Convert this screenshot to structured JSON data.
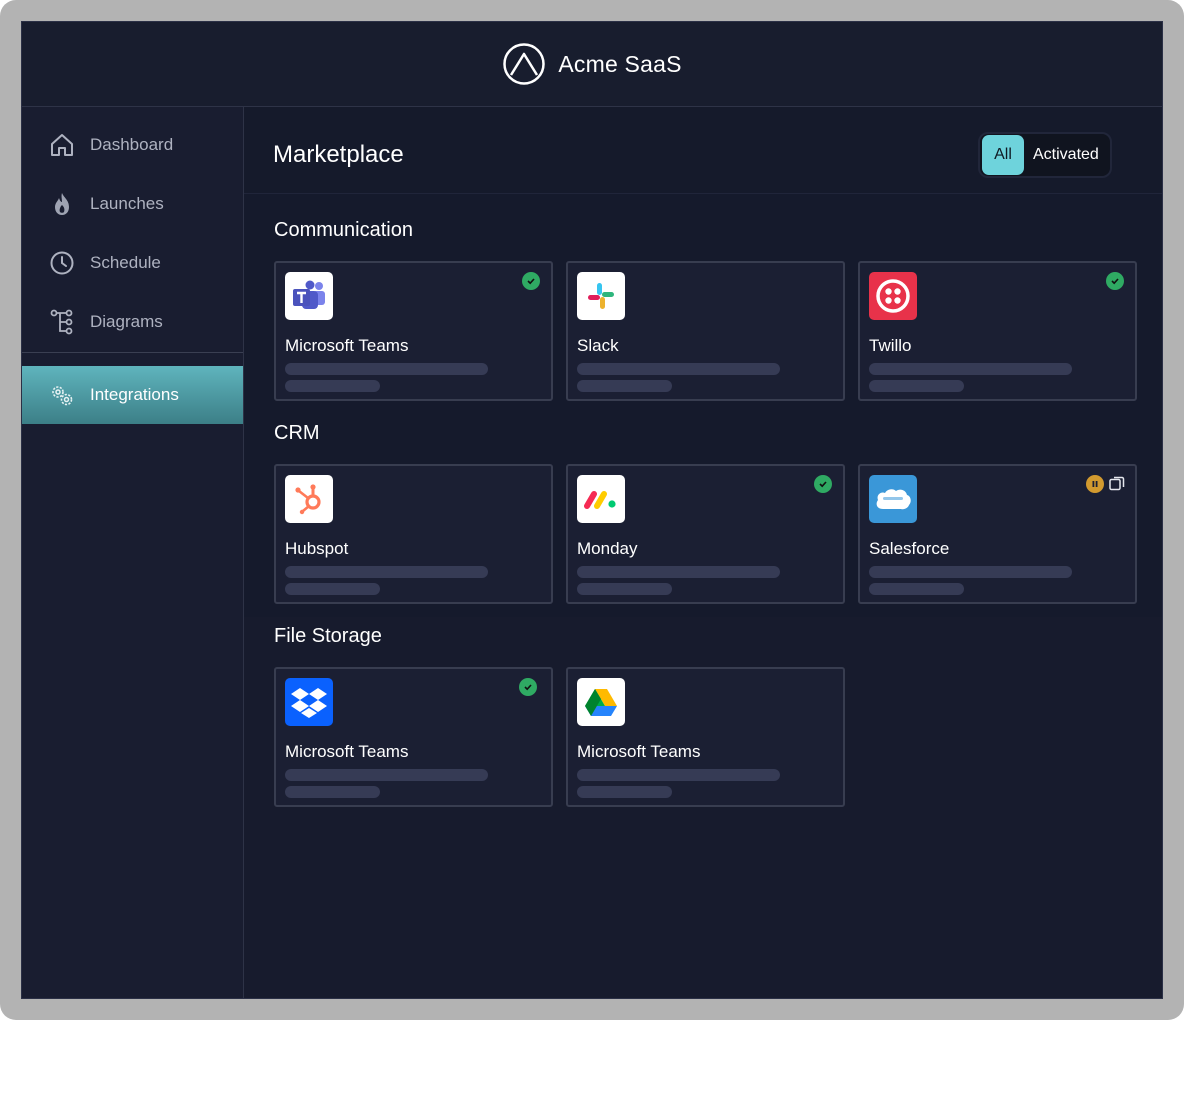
{
  "app": {
    "title": "Acme SaaS",
    "logo_icon": "peak-logo-icon"
  },
  "sidebar": {
    "items": [
      {
        "label": "Dashboard",
        "icon": "home-icon"
      },
      {
        "label": "Launches",
        "icon": "flame-icon"
      },
      {
        "label": "Schedule",
        "icon": "clock-icon"
      },
      {
        "label": "Diagrams",
        "icon": "tree-diagram-icon"
      }
    ],
    "active_item": {
      "label": "Integrations",
      "icon": "gears-icon"
    }
  },
  "main": {
    "title": "Marketplace",
    "filter": {
      "options": [
        "All",
        "Activated"
      ],
      "selected": "All"
    },
    "sections": [
      {
        "title": "Communication",
        "cards": [
          {
            "name": "Microsoft Teams",
            "icon": "microsoft-teams-icon",
            "status": "activated"
          },
          {
            "name": "Slack",
            "icon": "slack-icon",
            "status": "none"
          },
          {
            "name": "Twillo",
            "icon": "twilio-icon",
            "status": "activated"
          }
        ]
      },
      {
        "title": "CRM",
        "cards": [
          {
            "name": "Hubspot",
            "icon": "hubspot-icon",
            "status": "none"
          },
          {
            "name": "Monday",
            "icon": "monday-icon",
            "status": "activated"
          },
          {
            "name": "Salesforce",
            "icon": "salesforce-icon",
            "status": "paused"
          }
        ]
      },
      {
        "title": "File Storage",
        "cards": [
          {
            "name": "Microsoft Teams",
            "icon": "dropbox-icon",
            "status": "activated"
          },
          {
            "name": "Microsoft Teams",
            "icon": "google-drive-icon",
            "status": "none"
          }
        ]
      }
    ]
  },
  "colors": {
    "accent": "#6ed3dc",
    "active_nav": "#4f9aa2",
    "check": "#2faa63",
    "pause": "#d29a2f",
    "background": "#171b2d"
  }
}
